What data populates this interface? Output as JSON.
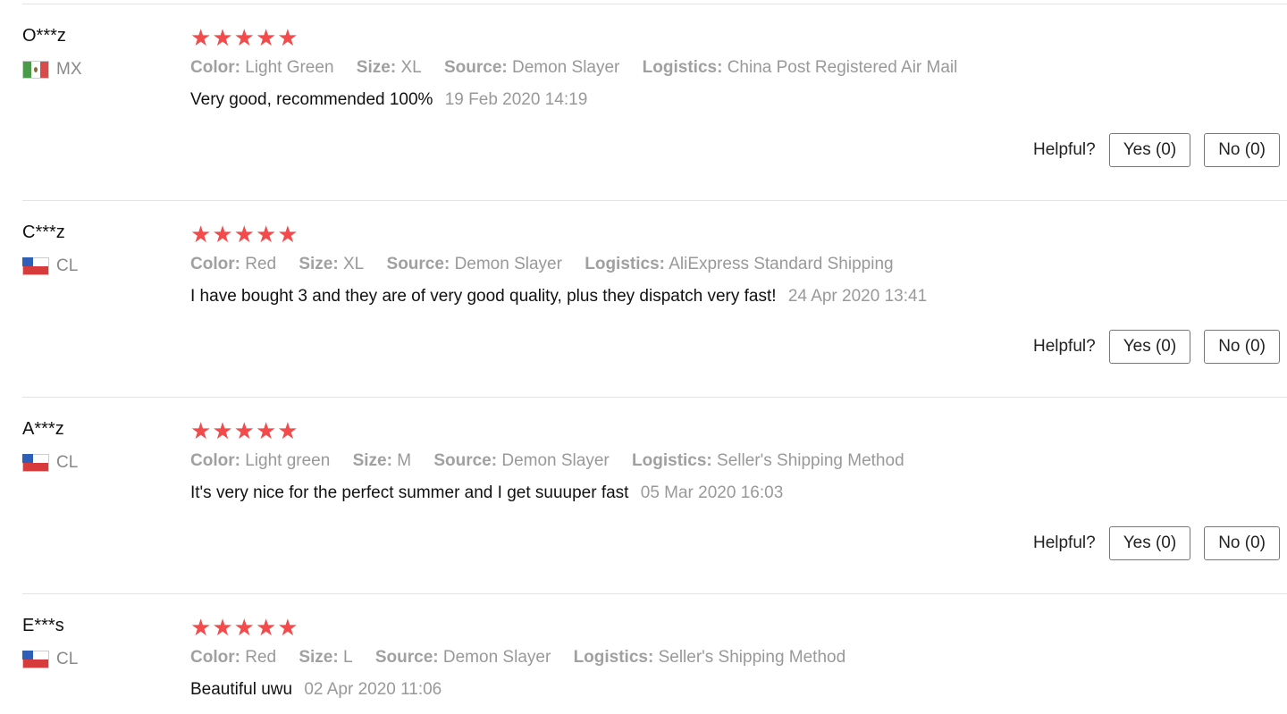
{
  "reviews": [
    {
      "user": "O***z",
      "country": "MX",
      "flag": "mx",
      "stars": 5,
      "attributes": [
        {
          "key": "Color:",
          "value": "Light Green"
        },
        {
          "key": "Size:",
          "value": "XL"
        },
        {
          "key": "Source:",
          "value": "Demon Slayer"
        },
        {
          "key": "Logistics:",
          "value": "China Post Registered Air Mail"
        }
      ],
      "comment": "Very good, recommended 100%",
      "date": "19 Feb 2020 14:19",
      "helpful_label": "Helpful?",
      "yes_label": "Yes (0)",
      "no_label": "No (0)"
    },
    {
      "user": "C***z",
      "country": "CL",
      "flag": "cl",
      "stars": 5,
      "attributes": [
        {
          "key": "Color:",
          "value": "Red"
        },
        {
          "key": "Size:",
          "value": "XL"
        },
        {
          "key": "Source:",
          "value": "Demon Slayer"
        },
        {
          "key": "Logistics:",
          "value": "AliExpress Standard Shipping"
        }
      ],
      "comment": "I have bought 3 and they are of very good quality, plus they dispatch very fast!",
      "date": "24 Apr 2020 13:41",
      "helpful_label": "Helpful?",
      "yes_label": "Yes (0)",
      "no_label": "No (0)"
    },
    {
      "user": "A***z",
      "country": "CL",
      "flag": "cl",
      "stars": 5,
      "attributes": [
        {
          "key": "Color:",
          "value": "Light green"
        },
        {
          "key": "Size:",
          "value": "M"
        },
        {
          "key": "Source:",
          "value": "Demon Slayer"
        },
        {
          "key": "Logistics:",
          "value": "Seller's Shipping Method"
        }
      ],
      "comment": "It's very nice for the perfect summer and I get suuuper fast",
      "date": "05 Mar 2020 16:03",
      "helpful_label": "Helpful?",
      "yes_label": "Yes (0)",
      "no_label": "No (0)"
    },
    {
      "user": "E***s",
      "country": "CL",
      "flag": "cl",
      "stars": 5,
      "attributes": [
        {
          "key": "Color:",
          "value": "Red"
        },
        {
          "key": "Size:",
          "value": "L"
        },
        {
          "key": "Source:",
          "value": "Demon Slayer"
        },
        {
          "key": "Logistics:",
          "value": "Seller's Shipping Method"
        }
      ],
      "comment": "Beautiful uwu",
      "date": "02 Apr 2020 11:06"
    }
  ],
  "colors": {
    "star": "#f34b4b",
    "muted_text": "#999999",
    "divider": "#e2e2e2"
  },
  "icons": {
    "star": "star-icon",
    "mx_flag": "mexico-flag-icon",
    "cl_flag": "chile-flag-icon"
  }
}
